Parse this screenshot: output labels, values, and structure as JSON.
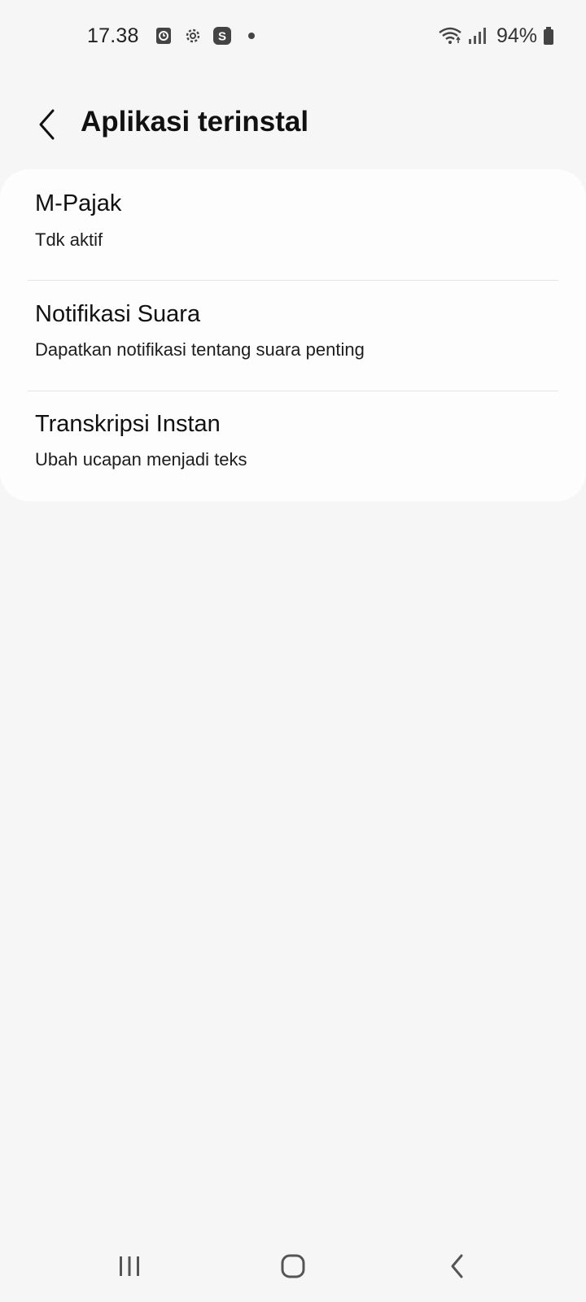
{
  "status_bar": {
    "time": "17.38",
    "battery": "94%",
    "icons": [
      "clock-app-icon",
      "settings-gear-icon",
      "s-app-icon",
      "dot-icon",
      "wifi-icon",
      "signal-icon",
      "battery-icon"
    ]
  },
  "header": {
    "title": "Aplikasi terinstal",
    "back_icon": "chevron-left-icon"
  },
  "items": [
    {
      "title": "M-Pajak",
      "subtitle": "Tdk aktif"
    },
    {
      "title": "Notifikasi Suara",
      "subtitle": "Dapatkan notifikasi tentang suara penting"
    },
    {
      "title": "Transkripsi Instan",
      "subtitle": "Ubah ucapan menjadi teks"
    }
  ],
  "nav_bar": {
    "icons": [
      "recent-apps-icon",
      "home-icon",
      "back-icon"
    ]
  },
  "colors": {
    "background": "#f6f6f6",
    "card": "#fdfdfd",
    "divider": "#e4e4e4",
    "text": "#111111"
  }
}
